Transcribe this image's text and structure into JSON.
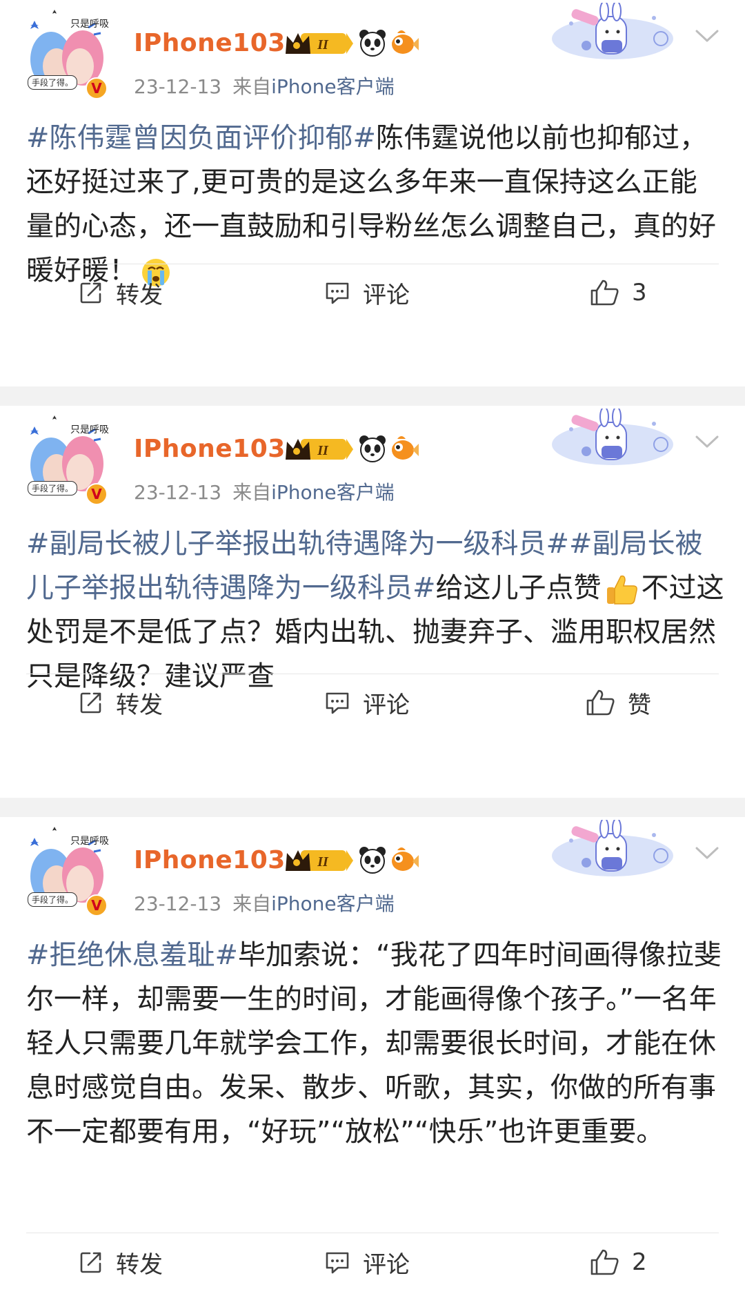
{
  "posts": [
    {
      "user": {
        "name": "IPhone103",
        "avatar_caption": "只是呼吸",
        "avatar_tag": "手段了得。",
        "badge_level": "II"
      },
      "date": "23-12-13",
      "source_prefix": "来自",
      "source_app": "iPhone客户端",
      "content": [
        {
          "type": "hashtag",
          "text": "#陈伟霆曾因负面评价抑郁#"
        },
        {
          "type": "text",
          "text": "陈伟霆说他以前也抑郁过，还好挺过来了,更可贵的是这么多年来一直保持这么正能量的心态，还一直鼓励和引导粉丝怎么调整自己，真的好暖好暖！"
        },
        {
          "type": "emoji",
          "name": "crying-emoji"
        }
      ],
      "actions": {
        "repost": "转发",
        "comment": "评论",
        "like": "3"
      }
    },
    {
      "user": {
        "name": "IPhone103",
        "avatar_caption": "只是呼吸",
        "avatar_tag": "手段了得。",
        "badge_level": "II"
      },
      "date": "23-12-13",
      "source_prefix": "来自",
      "source_app": "iPhone客户端",
      "content": [
        {
          "type": "hashtag",
          "text": "#副局长被儿子举报出轨待遇降为一级科员##副局长被儿子举报出轨待遇降为一级科员#"
        },
        {
          "type": "text",
          "text": "给这儿子点赞"
        },
        {
          "type": "emoji",
          "name": "thumbs-up-emoji"
        },
        {
          "type": "text",
          "text": "不过这处罚是不是低了点？婚内出轨、抛妻弃子、滥用职权居然只是降级？建议严查"
        }
      ],
      "actions": {
        "repost": "转发",
        "comment": "评论",
        "like": "赞"
      }
    },
    {
      "user": {
        "name": "IPhone103",
        "avatar_caption": "只是呼吸",
        "avatar_tag": "手段了得。",
        "badge_level": "II"
      },
      "date": "23-12-13",
      "source_prefix": "来自",
      "source_app": "iPhone客户端",
      "content": [
        {
          "type": "hashtag",
          "text": "#拒绝休息羞耻#"
        },
        {
          "type": "text",
          "text": "毕加索说：“我花了四年时间画得像拉斐尔一样，却需要一生的时间，才能画得像个孩子。”一名年轻人只需要几年就学会工作，却需要很长时间，才能在休息时感觉自由。发呆、散步、听歌，其实，你做的所有事不一定都要有用，“好玩”“放松”“快乐”也许更重要。"
        }
      ],
      "actions": {
        "repost": "转发",
        "comment": "评论",
        "like": "2"
      }
    }
  ],
  "colors": {
    "username": "#e8662a",
    "hashtag": "#51698f",
    "meta": "#8a8a8a",
    "text": "#222222",
    "divider": "#e6e6e6",
    "page_bg": "#f2f2f2"
  }
}
